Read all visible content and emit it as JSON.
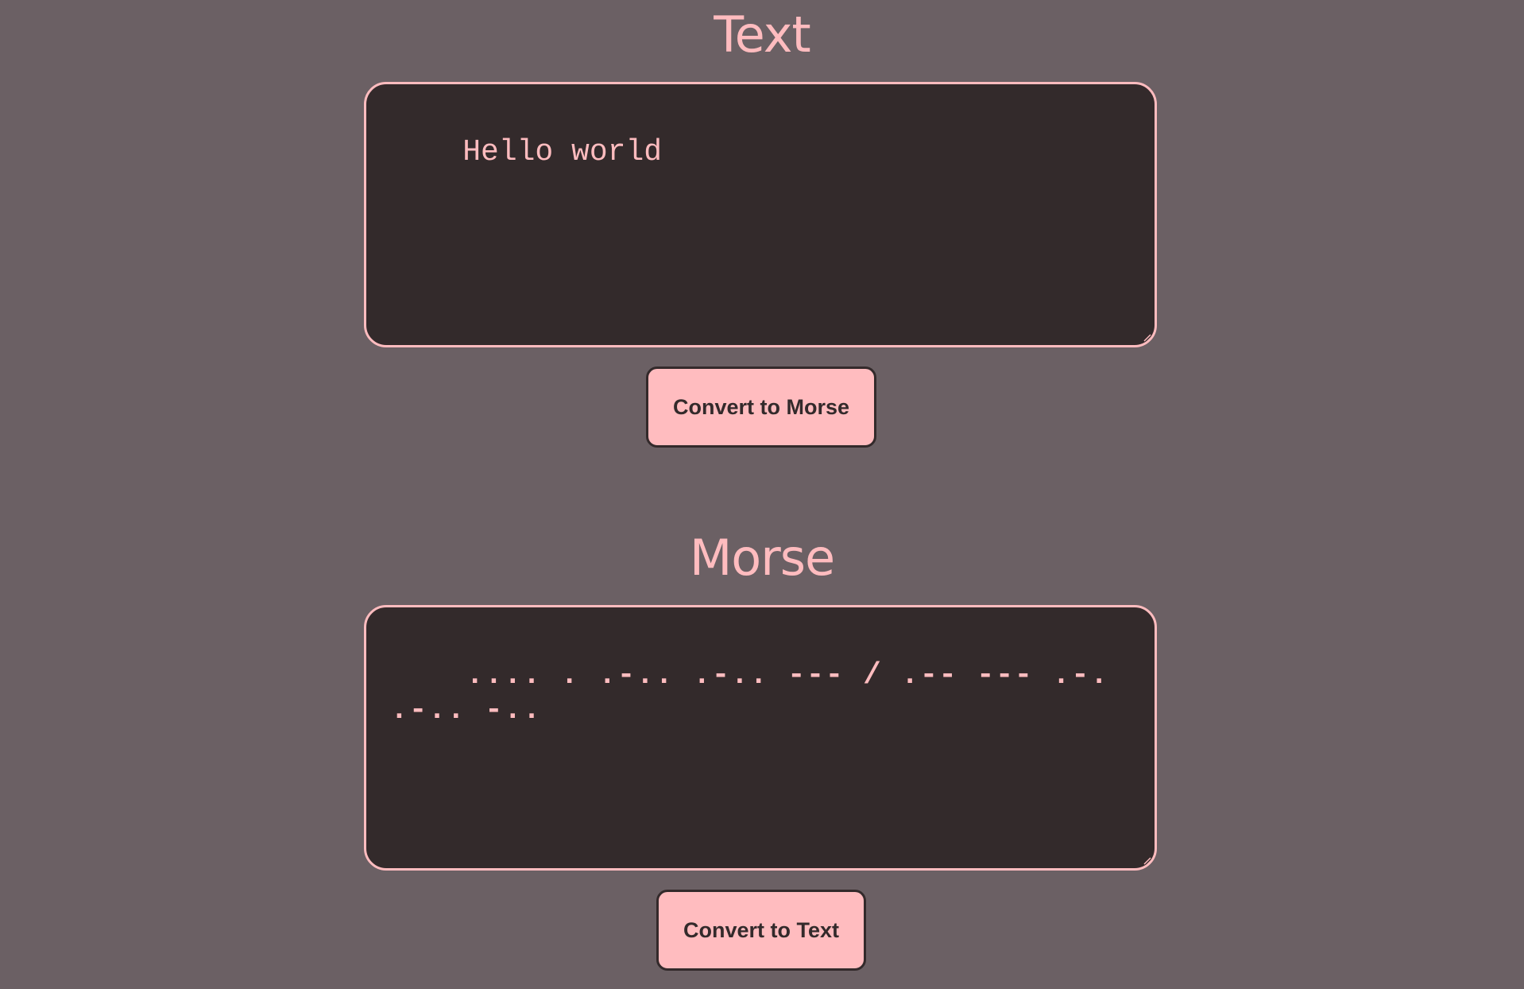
{
  "text_section": {
    "heading": "Text",
    "input_value": "Hello world",
    "button_label": "Convert to Morse"
  },
  "morse_section": {
    "heading": "Morse",
    "input_value": ".... . .-.. .-.. --- / .-- --- .-. .-.. -..",
    "button_label": "Convert to Text"
  },
  "colors": {
    "background": "#6b6064",
    "accent": "#ffbcbf",
    "panel": "#332a2b"
  }
}
